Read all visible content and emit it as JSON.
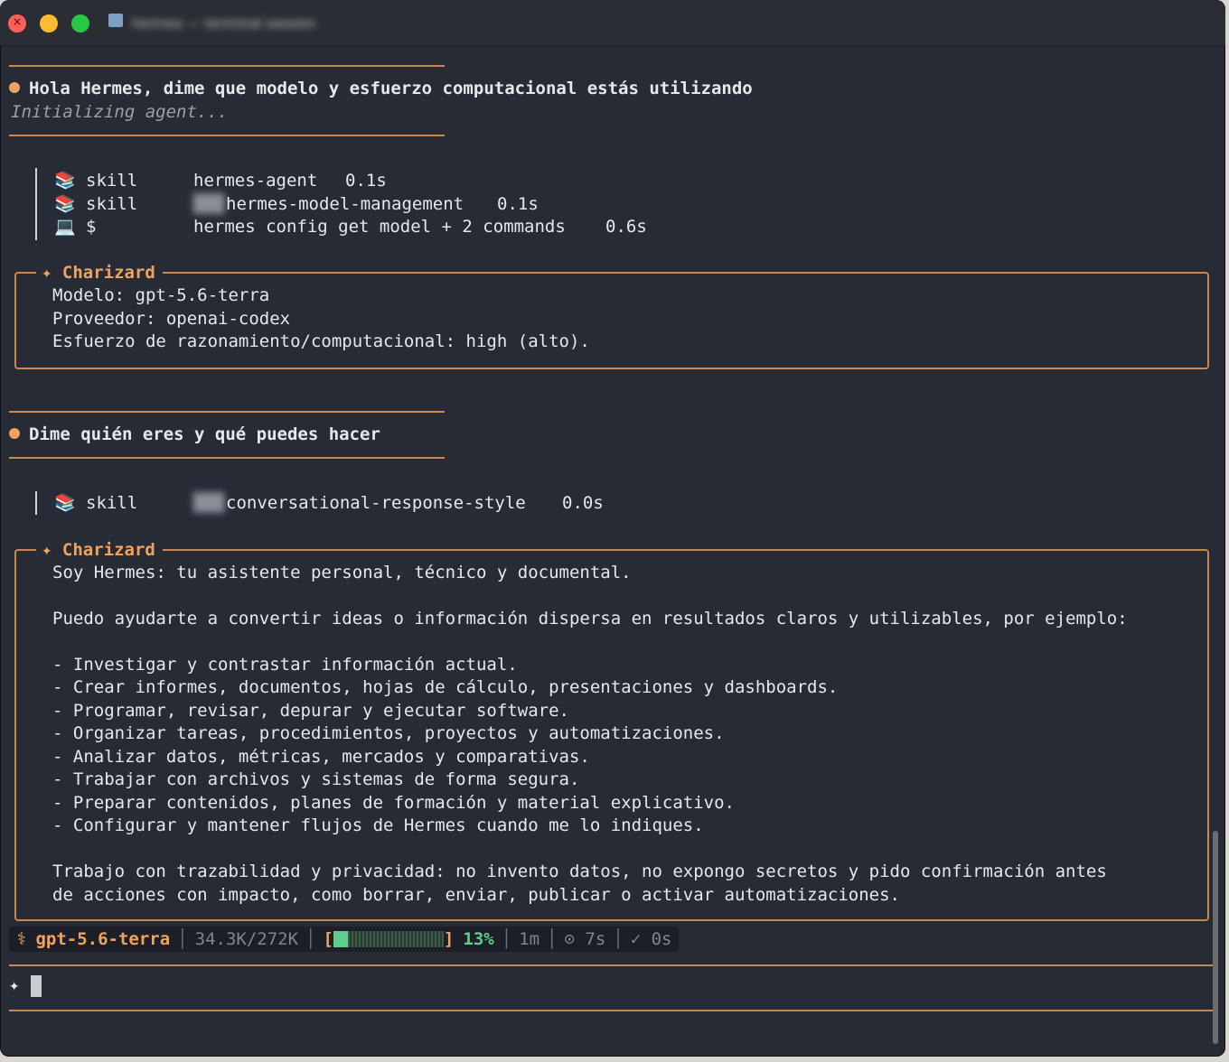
{
  "window": {
    "title": "hermes — terminal session"
  },
  "conversation": {
    "msg1": {
      "user": "Hola Hermes, dime que modelo y esfuerzo computacional estás utilizando",
      "status": "Initializing agent...",
      "tools": [
        {
          "icon": "📚",
          "kind": "skill",
          "name": "hermes-agent",
          "time": "0.1s"
        },
        {
          "icon": "📚",
          "kind": "skill",
          "name": "hermes-model-management",
          "time": "0.1s"
        },
        {
          "icon": "💻",
          "kind": "$",
          "name": "hermes config get model + 2 commands",
          "time": "0.6s"
        }
      ],
      "agent": "Charizard",
      "reply": [
        "Modelo: gpt-5.6-terra",
        "Proveedor: openai-codex",
        "Esfuerzo de razonamiento/computacional: high (alto)."
      ]
    },
    "msg2": {
      "user": "Dime quién eres y qué puedes hacer",
      "tools": [
        {
          "icon": "📚",
          "kind": "skill",
          "name": "conversational-response-style",
          "time": "0.0s"
        }
      ],
      "agent": "Charizard",
      "reply": [
        "Soy Hermes: tu asistente personal, técnico y documental.",
        "",
        "Puedo ayudarte a convertir ideas o información dispersa en resultados claros y utilizables, por ejemplo:",
        "",
        "- Investigar y contrastar información actual.",
        "- Crear informes, documentos, hojas de cálculo, presentaciones y dashboards.",
        "- Programar, revisar, depurar y ejecutar software.",
        "- Organizar tareas, procedimientos, proyectos y automatizaciones.",
        "- Analizar datos, métricas, mercados y comparativas.",
        "- Trabajar con archivos y sistemas de forma segura.",
        "- Preparar contenidos, planes de formación y material explicativo.",
        "- Configurar y mantener flujos de Hermes cuando me lo indiques.",
        "",
        "Trabajo con trazabilidad y privacidad: no invento datos, no expongo secretos y pido confirmación antes",
        "de acciones con impacto, como borrar, enviar, publicar o activar automatizaciones."
      ]
    }
  },
  "statusbar": {
    "icon": "⚕",
    "model": "gpt-5.6-terra",
    "tokens": "34.3K/272K",
    "bracket_open": "[",
    "bracket_close": "]",
    "context_fraction": 0.13,
    "context_pct": "13%",
    "elapsed": "1m",
    "timer": "⊙ 7s",
    "check": "✓ 0s"
  },
  "input": {
    "prompt": "✦"
  },
  "colors": {
    "accent": "#c8894e",
    "accent_text": "#f0a35e",
    "bg": "#262b36",
    "success": "#5fce8c"
  }
}
